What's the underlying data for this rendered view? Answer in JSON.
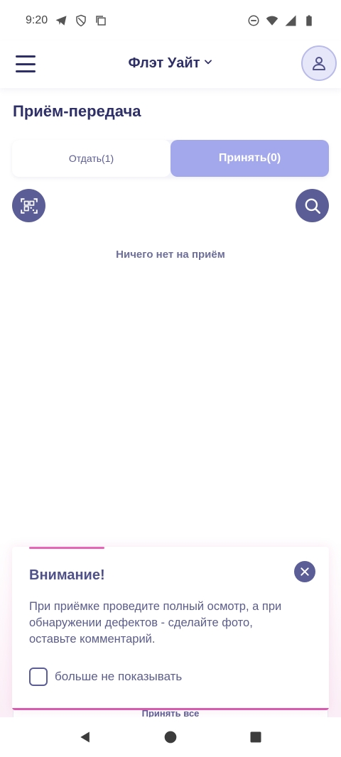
{
  "status_bar": {
    "time": "9:20",
    "icons_left": [
      "telegram-icon",
      "shield-icon",
      "copy-icon"
    ],
    "icons_right": [
      "do-not-disturb-icon",
      "wifi-icon",
      "signal-icon",
      "battery-icon"
    ]
  },
  "header": {
    "title": "Флэт Уайт",
    "menu_icon": "menu-icon",
    "profile_icon": "user-icon"
  },
  "page": {
    "title": "Приём-передача"
  },
  "tabs": [
    {
      "label": "Отдать(1)",
      "active": false
    },
    {
      "label": "Принять(0)",
      "active": true
    }
  ],
  "actions": {
    "qr_icon": "qr-scan-icon",
    "search_icon": "search-icon"
  },
  "empty_state": {
    "text": "Ничего нет на приём"
  },
  "notice": {
    "title": "Внимание!",
    "text": "При приёмке проведите полный осмотр, а при обнаружении дефектов - сделайте фото, оставьте комментарий.",
    "checkbox_label": "больше не показывать",
    "checkbox_checked": false
  },
  "bottom": {
    "accept_all_label": "Принять все"
  },
  "nav": [
    "back-icon",
    "home-icon",
    "recents-icon"
  ],
  "colors": {
    "primary": "#5b5d96",
    "tab_active": "#a3a7ec",
    "accent_pink": "#e765b6",
    "text_dark": "#2e2f66"
  }
}
